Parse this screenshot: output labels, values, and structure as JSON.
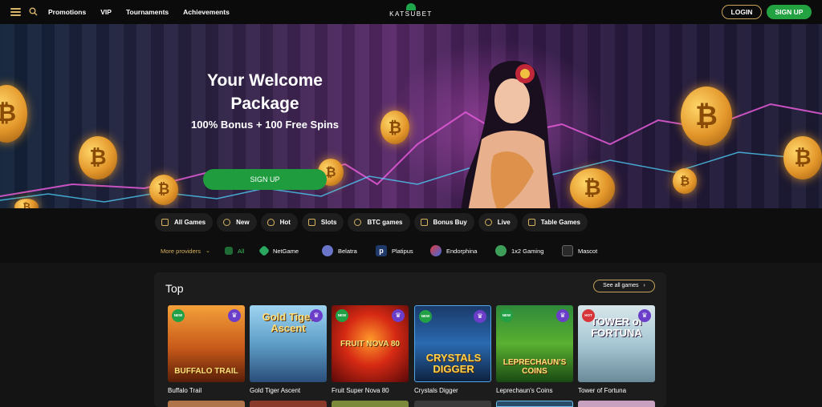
{
  "nav": {
    "items": [
      "Promotions",
      "VIP",
      "Tournaments",
      "Achievements"
    ],
    "logo": "KATSUBET",
    "login": "LOGIN",
    "signup": "SIGN UP"
  },
  "hero": {
    "title_line1": "Your Welcome",
    "title_line2": "Package",
    "subtitle": "100% Bonus + 100 Free Spins",
    "cta": "SIGN UP"
  },
  "categories": [
    "All Games",
    "New",
    "Hot",
    "Slots",
    "BTC games",
    "Bonus Buy",
    "Live",
    "Table Games"
  ],
  "providers": {
    "more_label": "More providers",
    "items": [
      "All",
      "NetGame",
      "Belatra",
      "Platipus",
      "Endorphina",
      "1x2 Gaming",
      "Mascot"
    ]
  },
  "section": {
    "title": "Top",
    "see_all": "See all games"
  },
  "games": [
    {
      "name": "Buffalo Trail",
      "art": "BUFFALO TRAIL",
      "badge": "NEW"
    },
    {
      "name": "Gold Tiger Ascent",
      "art": "Gold Tiger Ascent",
      "badge": ""
    },
    {
      "name": "Fruit Super Nova 80",
      "art": "FRUIT NOVA 80",
      "badge": "NEW"
    },
    {
      "name": "Crystals Digger",
      "art": "CRYSTALS DIGGER",
      "badge": "NEW"
    },
    {
      "name": "Leprechaun's Coins",
      "art": "LEPRECHAUN'S COINS",
      "badge": "NEW"
    },
    {
      "name": "Tower of Fortuna",
      "art": "TOWER of FORTUNA",
      "badge": "HOT"
    }
  ],
  "colors": {
    "accent_gold": "#c9a55b",
    "brand_green": "#23a242",
    "badge_purple": "#6a3ec9"
  },
  "icons": {
    "menu": "hamburger-icon",
    "search": "search-icon",
    "favorite": "crown-icon"
  }
}
